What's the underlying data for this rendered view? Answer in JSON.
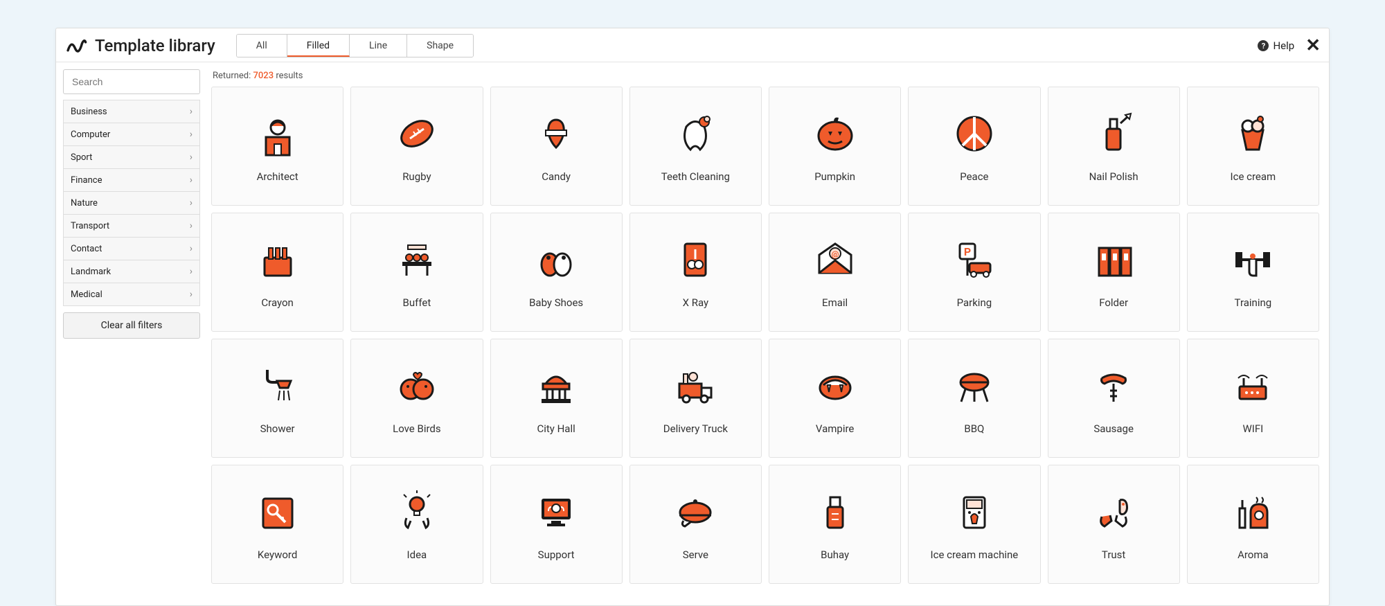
{
  "app": {
    "title": "Template library"
  },
  "tabs": [
    {
      "label": "All",
      "active": false
    },
    {
      "label": "Filled",
      "active": true
    },
    {
      "label": "Line",
      "active": false
    },
    {
      "label": "Shape",
      "active": false
    }
  ],
  "header": {
    "help_label": "Help"
  },
  "sidebar": {
    "search_placeholder": "Search",
    "clear_label": "Clear all filters",
    "categories": [
      "Business",
      "Computer",
      "Sport",
      "Finance",
      "Nature",
      "Transport",
      "Contact",
      "Landmark",
      "Medical"
    ]
  },
  "results": {
    "prefix": "Returned:",
    "count": "7023",
    "suffix": "results"
  },
  "cards": [
    {
      "label": "Architect",
      "icon": "architect"
    },
    {
      "label": "Rugby",
      "icon": "rugby"
    },
    {
      "label": "Candy",
      "icon": "candy"
    },
    {
      "label": "Teeth Cleaning",
      "icon": "teeth"
    },
    {
      "label": "Pumpkin",
      "icon": "pumpkin"
    },
    {
      "label": "Peace",
      "icon": "peace"
    },
    {
      "label": "Nail Polish",
      "icon": "nailpolish"
    },
    {
      "label": "Ice cream",
      "icon": "icecream"
    },
    {
      "label": "Crayon",
      "icon": "crayon"
    },
    {
      "label": "Buffet",
      "icon": "buffet"
    },
    {
      "label": "Baby Shoes",
      "icon": "babyshoes"
    },
    {
      "label": "X Ray",
      "icon": "xray"
    },
    {
      "label": "Email",
      "icon": "email"
    },
    {
      "label": "Parking",
      "icon": "parking"
    },
    {
      "label": "Folder",
      "icon": "folder"
    },
    {
      "label": "Training",
      "icon": "training"
    },
    {
      "label": "Shower",
      "icon": "shower"
    },
    {
      "label": "Love Birds",
      "icon": "lovebirds"
    },
    {
      "label": "City Hall",
      "icon": "cityhall"
    },
    {
      "label": "Delivery Truck",
      "icon": "truck"
    },
    {
      "label": "Vampire",
      "icon": "vampire"
    },
    {
      "label": "BBQ",
      "icon": "bbq"
    },
    {
      "label": "Sausage",
      "icon": "sausage"
    },
    {
      "label": "WIFI",
      "icon": "wifi"
    },
    {
      "label": "Keyword",
      "icon": "keyword"
    },
    {
      "label": "Idea",
      "icon": "idea"
    },
    {
      "label": "Support",
      "icon": "support"
    },
    {
      "label": "Serve",
      "icon": "serve"
    },
    {
      "label": "Buhay",
      "icon": "buhay"
    },
    {
      "label": "Ice cream machine",
      "icon": "icecreammachine"
    },
    {
      "label": "Trust",
      "icon": "trust"
    },
    {
      "label": "Aroma",
      "icon": "aroma"
    }
  ],
  "colors": {
    "accent": "#ef5b2b",
    "stroke": "#1a1a1a",
    "light": "#ffe2d6"
  }
}
